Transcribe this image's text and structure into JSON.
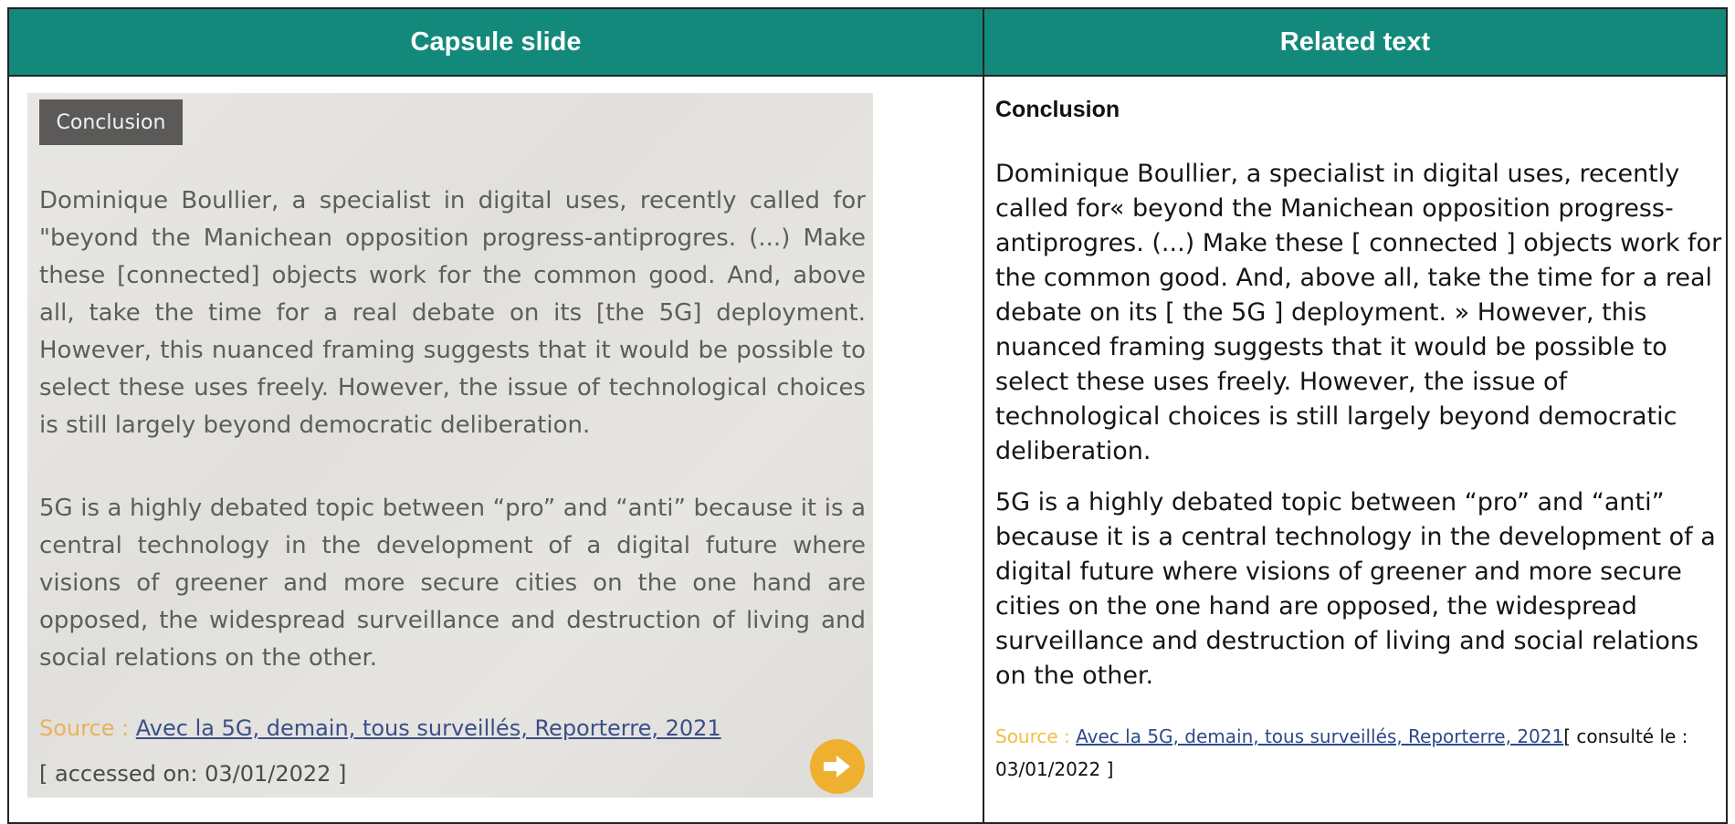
{
  "headers": {
    "left": "Capsule slide",
    "right": "Related text"
  },
  "slide": {
    "tag": "Conclusion",
    "paragraph1": "Dominique Boullier, a specialist in digital uses, recently called for \"beyond the Manichean opposition progress-antiprogres. (...) Make these [connected] objects work for the common good. And, above all, take the time for a real debate on its [the 5G] deployment. However, this nuanced framing suggests that it would be possible to select these uses freely. However, the issue of technological choices is still largely beyond democratic deliberation.",
    "paragraph2": "5G is a highly debated topic between “pro” and “anti” because it is a central technology in the development of a digital future where visions of greener and more secure cities on the one hand are opposed, the widespread surveillance and destruction of living and social relations on the other.",
    "source_label": "Source : ",
    "source_link": "Avec la 5G, demain, tous surveillés, Reporterre, 2021",
    "accessed": "[ accessed on: 03/01/2022 ]",
    "next_icon": "arrow-right-icon",
    "accent_color": "#f0b02f"
  },
  "related": {
    "heading": "Conclusion",
    "paragraph1": "Dominique Boullier, a specialist in digital uses, recently called for« beyond the Manichean opposition progress-antiprogres. (...) Make these [ connected ] objects work for the common good. And, above all, take the time for a real debate on its [ the 5G ] deployment. » However, this nuanced framing suggests that it would be possible to select these uses freely. However, the issue of technological choices is still largely beyond democratic deliberation.",
    "paragraph2": "5G is a highly debated topic between “pro” and “anti” because it is a central technology in the development of a digital future where visions of greener and more secure cities on the one hand are opposed, the widespread surveillance and destruction of living and social relations on the other.",
    "source_label": "Source : ",
    "source_link": "Avec la 5G, demain, tous surveillés, Reporterre, 2021",
    "source_suffix": "[ consulté le : 03/01/2022 ]"
  },
  "colors": {
    "header_bg": "#13897b",
    "header_text": "#ffffff"
  }
}
